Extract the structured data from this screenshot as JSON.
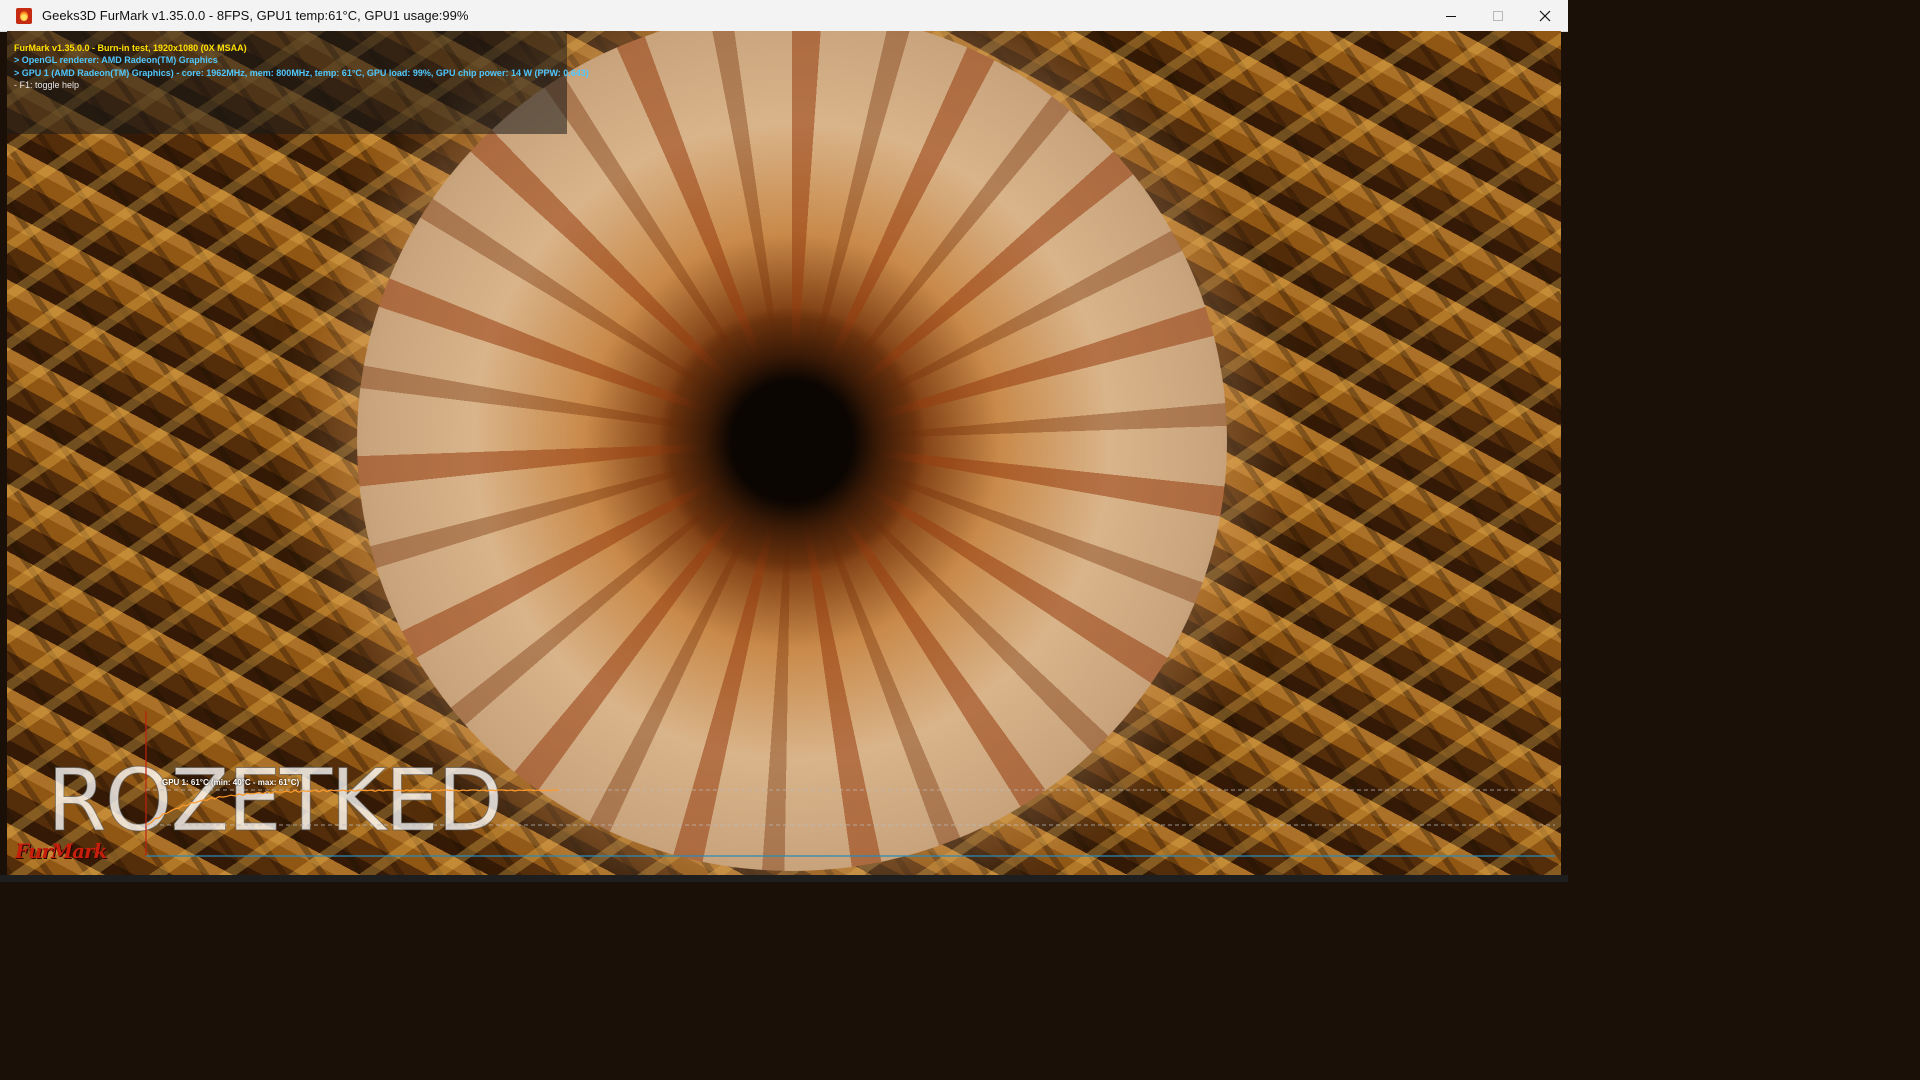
{
  "window": {
    "title": "Geeks3D FurMark v1.35.0.0 - 8FPS, GPU1 temp:61°C, GPU1 usage:99%",
    "icon": "furmark-app-icon"
  },
  "overlay": {
    "line1": "FurMark v1.35.0.0 - Burn-in test, 1920x1080 (0X MSAA)",
    "line2": "> OpenGL renderer: AMD Radeon(TM) Graphics",
    "line3": "> GPU 1 (AMD Radeon(TM) Graphics) - core: 1962MHz, mem: 800MHz, temp: 61°C, GPU load: 99%, GPU chip power: 14 W (PPW: 0.643)",
    "line4": "- F1: toggle help"
  },
  "graph": {
    "label": "GPU 1: 61°C (min: 40°C - max: 61°C)",
    "current_temp": 61,
    "min_temp": 40,
    "max_temp": 61
  },
  "watermark": "ROZETKED",
  "logo_text": "FurMark",
  "colors": {
    "overlay_title": "#ffe000",
    "overlay_info": "#4fc8ff",
    "graph_line": "#ff9a2a",
    "graph_axis": "#2a8ab8"
  }
}
